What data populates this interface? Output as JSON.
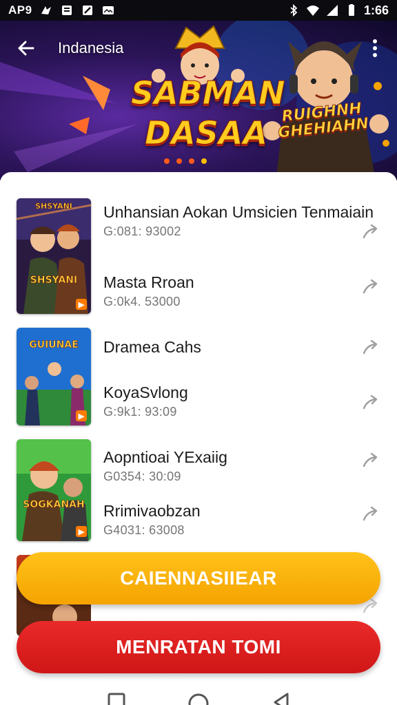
{
  "status_bar": {
    "carrier": "AP9",
    "time": "1:66",
    "icons": [
      "sim-icon",
      "message-icon",
      "notification-icon",
      "photo-icon",
      "bluetooth-icon",
      "wifi-icon",
      "signal-icon",
      "battery-icon"
    ]
  },
  "toolbar": {
    "title": "Indanesia",
    "back_icon": "arrow-left-icon",
    "more_icon": "more-vertical-icon"
  },
  "banner": {
    "title_line1": "SABMAN",
    "title_line2": "DASAA",
    "subtitle_line1": "RUIGHNH",
    "subtitle_line2": "GHEHIAHN",
    "dots": 4,
    "active_dot": 3
  },
  "games": [
    {
      "logo": "SHSYANI",
      "items": [
        {
          "title": "Unhansian Aokan Umsicien Tenmaiain",
          "meta": "G:081: 93002"
        },
        {
          "title": "Masta Rroan",
          "meta": "G:0k4. 53000"
        }
      ]
    },
    {
      "logo": "GUIUNAE",
      "items": [
        {
          "title": "Dramea Cahs",
          "meta": ""
        },
        {
          "title": "KoyaSvlong",
          "meta": "G:9k1: 93:09"
        }
      ]
    },
    {
      "logo": "SOGKANAH",
      "items": [
        {
          "title": "Aopntioai YExaiig",
          "meta": "G0354: 30:09"
        },
        {
          "title": "Rrimivaobzan",
          "meta": "G4031: 63008"
        }
      ]
    }
  ],
  "buttons": {
    "primary": "CAIENNASIIEAR",
    "secondary": "MENRATAN TOMI"
  },
  "colors": {
    "primary_button": "#f5a300",
    "secondary_button": "#d91c1c",
    "banner_bg": "#2b1458"
  },
  "nav": [
    "back-nav-icon",
    "home-nav-icon",
    "recents-nav-icon"
  ]
}
